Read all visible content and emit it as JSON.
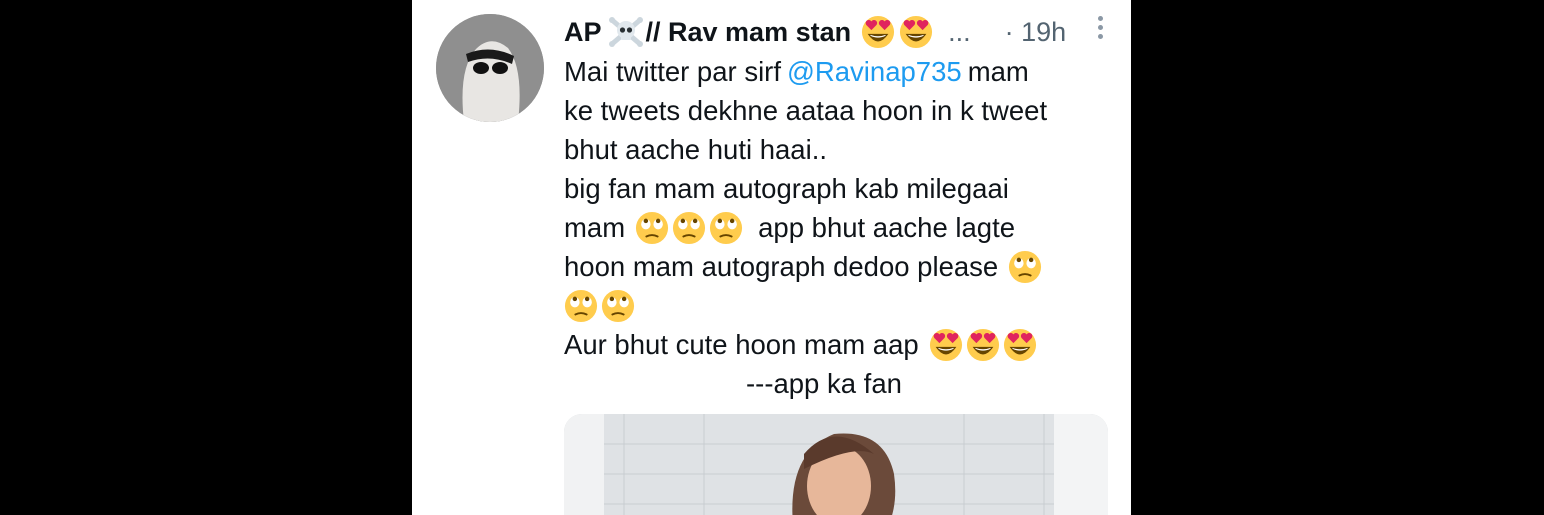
{
  "tweet": {
    "author_name_prefix": "AP",
    "author_name_suffix": "// Rav mam stan",
    "name_truncation": "...",
    "time": "· 19h",
    "lines": [
      {
        "parts": [
          "Mai twitter par sirf",
          "@Ravinap735",
          "mam"
        ]
      },
      {
        "text": "ke tweets dekhne aataa hoon in k tweet"
      },
      {
        "text": "bhut aache huti haai.."
      },
      {
        "text": "big fan mam autograph kab milegaai"
      },
      {
        "parts": [
          "mam",
          "app bhut aache lagte"
        ]
      },
      {
        "text": "hoon mam autograph dedoo please"
      },
      {
        "text": ""
      },
      {
        "text": "Aur bhut cute hoon mam aap"
      },
      {
        "text": "---app ka fan"
      }
    ],
    "emojis": {
      "name": [
        "heart-eyes-icon",
        "heart-eyes-icon"
      ],
      "line5": [
        "rolling-eyes-icon",
        "rolling-eyes-icon",
        "rolling-eyes-icon"
      ],
      "line6": [
        "rolling-eyes-icon"
      ],
      "line7": [
        "rolling-eyes-icon",
        "rolling-eyes-icon"
      ],
      "line8": [
        "heart-eyes-icon",
        "heart-eyes-icon",
        "heart-eyes-icon"
      ]
    },
    "colors": {
      "mention": "#1d9bf0",
      "text": "#0f1419",
      "muted": "#536471"
    }
  }
}
